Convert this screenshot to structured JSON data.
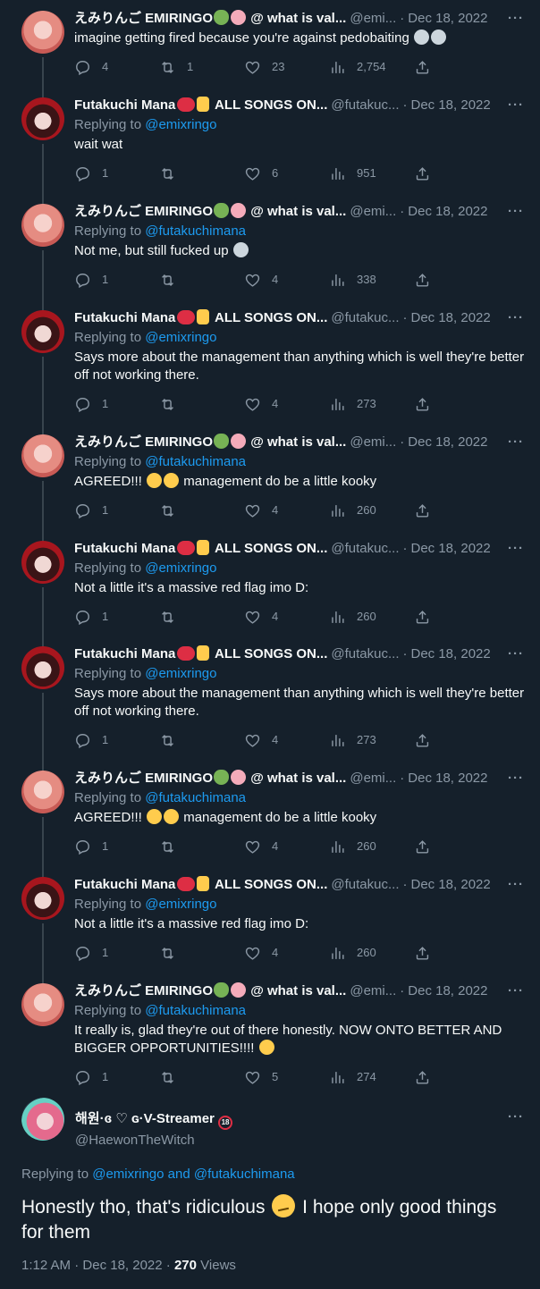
{
  "users": {
    "emi": {
      "name": "えみりんご EMIRINGO",
      "name_suffix": "@ what is val...",
      "handle": "@emi...",
      "handle_alt": "@emi..."
    },
    "futa": {
      "name": "Futakuchi Mana",
      "name_suffix": "ALL SONGS ON...",
      "handle": "@futakuc..."
    }
  },
  "tweets": [
    {
      "user": "emi",
      "date": "Dec 18, 2022",
      "replying_to": "",
      "text": "imagine getting fired because you're against pedobaiting",
      "reply": "4",
      "retweet": "1",
      "like": "23",
      "views": "2,754"
    },
    {
      "user": "futa",
      "date": "Dec 18, 2022",
      "replying_to": "@emixringo",
      "text": "wait wat",
      "reply": "1",
      "retweet": "",
      "like": "6",
      "views": "951"
    },
    {
      "user": "emi",
      "date": "Dec 18, 2022",
      "replying_to": "@futakuchimana",
      "text": "Not me, but still fucked up",
      "reply": "1",
      "retweet": "",
      "like": "4",
      "views": "338"
    },
    {
      "user": "futa",
      "date": "Dec 18, 2022",
      "replying_to": "@emixringo",
      "text": "Says more about the management than anything which is well they're better off not working there.",
      "reply": "1",
      "retweet": "",
      "like": "4",
      "views": "273"
    },
    {
      "user": "emi",
      "date": "Dec 18, 2022",
      "replying_to": "@futakuchimana",
      "text": "management do be a little kooky",
      "text_prefix": "AGREED!!!",
      "reply": "1",
      "retweet": "",
      "like": "4",
      "views": "260"
    },
    {
      "user": "futa",
      "date": "Dec 18, 2022",
      "replying_to": "@emixringo",
      "text": "Not a little it's a massive red flag imo D:",
      "reply": "1",
      "retweet": "",
      "like": "4",
      "views": "260"
    },
    {
      "user": "futa",
      "date": "Dec 18, 2022",
      "replying_to": "@emixringo",
      "text": "Says more about the management than anything which is well they're better off not working there.",
      "reply": "1",
      "retweet": "",
      "like": "4",
      "views": "273"
    },
    {
      "user": "emi",
      "date": "Dec 18, 2022",
      "replying_to": "@futakuchimana",
      "text": "management do be a little kooky",
      "text_prefix": "AGREED!!!",
      "reply": "1",
      "retweet": "",
      "like": "4",
      "views": "260"
    },
    {
      "user": "futa",
      "date": "Dec 18, 2022",
      "replying_to": "@emixringo",
      "text": "Not a little it's a massive red flag imo D:",
      "reply": "1",
      "retweet": "",
      "like": "4",
      "views": "260"
    },
    {
      "user": "emi",
      "date": "Dec 18, 2022",
      "replying_to": "@futakuchimana",
      "text": "It really is, glad they're out of there honestly. NOW ONTO BETTER AND BIGGER OPPORTUNITIES!!!!",
      "reply": "1",
      "retweet": "",
      "like": "5",
      "views": "274"
    }
  ],
  "labels": {
    "replying": "Replying to",
    "and": "and",
    "more": "···",
    "sep": "·"
  },
  "main": {
    "name": "해원·ɞ ♡ ɢ·V-Streamer",
    "handle": "@HaewonTheWitch",
    "replying_to_1": "@emixringo",
    "replying_to_2": "@futakuchimana",
    "text_1": "Honestly tho, that's ridiculous",
    "text_2": "I hope only good things for them",
    "time": "1:12 AM",
    "date": "Dec 18, 2022",
    "views_count": "270",
    "views_label": "Views"
  },
  "colors": {
    "background": "#15202b",
    "text": "#f7f9f9",
    "secondary": "#8b98a5",
    "accent": "#1d9bf0",
    "thread_line": "#38444d"
  },
  "icons": [
    "reply-icon",
    "retweet-icon",
    "like-icon",
    "views-icon",
    "share-icon",
    "more-icon"
  ]
}
